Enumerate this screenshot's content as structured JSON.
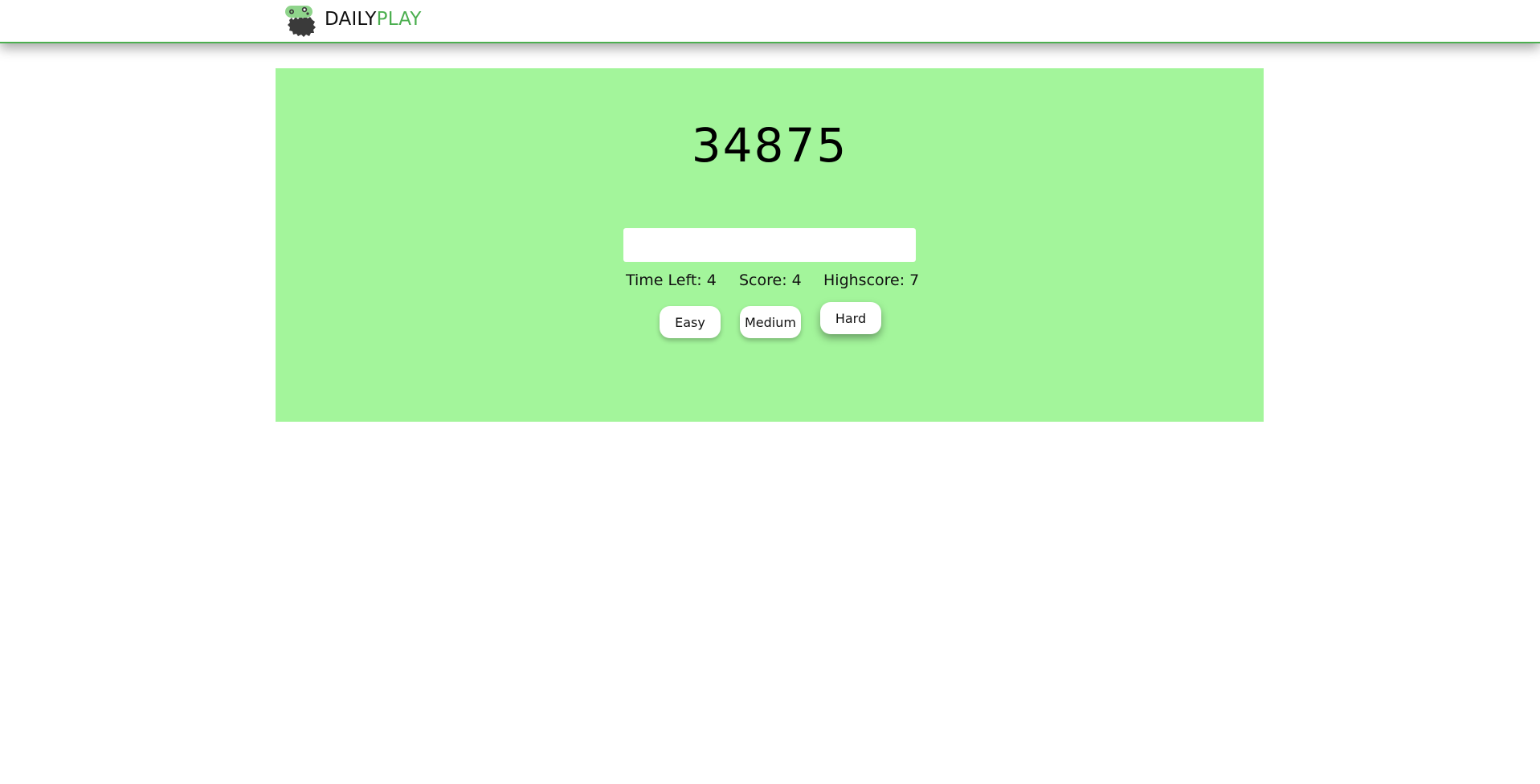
{
  "header": {
    "brand_part1": "DAILY",
    "brand_part2": "PLAY",
    "logo_icon": "gamepad-on-blob-icon",
    "accent_color": "#4caf50"
  },
  "game": {
    "target_number": "34875",
    "answer_value": "",
    "panel_color": "#a3f59b",
    "stats": {
      "time_left": "Time Left: 4",
      "score": "Score: 4",
      "highscore": "Highscore: 7"
    },
    "difficulty": {
      "easy_label": "Easy",
      "medium_label": "Medium",
      "hard_label": "Hard"
    }
  }
}
